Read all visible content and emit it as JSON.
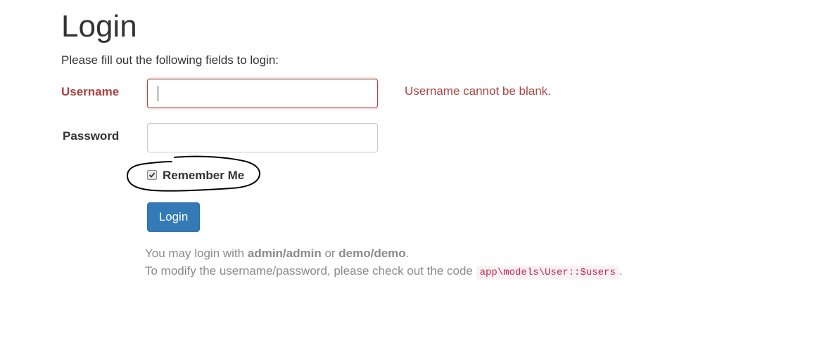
{
  "page": {
    "title": "Login",
    "intro": "Please fill out the following fields to login:"
  },
  "form": {
    "username_label": "Username",
    "username_value": "",
    "username_error": "Username cannot be blank.",
    "password_label": "Password",
    "password_value": "",
    "remember_label": "Remember Me",
    "remember_checked": true,
    "submit_label": "Login"
  },
  "help": {
    "line1_prefix": "You may login with ",
    "line1_cred1": "admin/admin",
    "line1_mid": " or ",
    "line1_cred2": "demo/demo",
    "line1_suffix": ".",
    "line2_prefix": "To modify the username/password, please check out the code ",
    "line2_code": "app\\models\\User::$users",
    "line2_suffix": "."
  },
  "colors": {
    "error": "#a94442",
    "primary_button": "#337ab7",
    "code_text": "#c7254e",
    "code_bg": "#f9f2f4",
    "muted_text": "#8a8a8a"
  },
  "icons": {
    "checkbox_mark": "checkmark-icon"
  }
}
